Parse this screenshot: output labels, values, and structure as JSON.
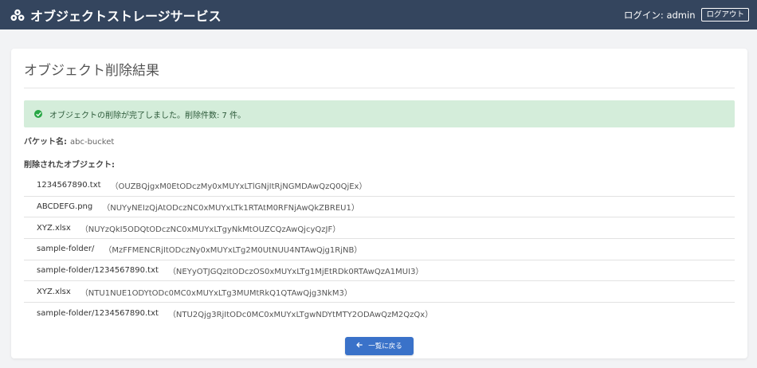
{
  "header": {
    "app_title": "オブジェクトストレージサービス",
    "login_text": "ログイン: admin",
    "logout_label": "ログアウト"
  },
  "main": {
    "title": "オブジェクト削除結果",
    "alert_message": "オブジェクトの削除が完了しました。削除件数: 7 件。",
    "bucket_label": "バケット名:",
    "bucket_value": "abc-bucket",
    "objects_label": "削除されたオブジェクト:",
    "objects": [
      {
        "name": "1234567890.txt",
        "id": "（OUZBQjgxM0EtODczMy0xMUYxLTlGNjItRjNGMDAwQzQ0QjEx）"
      },
      {
        "name": "ABCDEFG.png",
        "id": "（NUYyNEIzQjAtODczNC0xMUYxLTk1RTAtM0RFNjAwQkZBREU1）"
      },
      {
        "name": "XYZ.xlsx",
        "id": "（NUYzQkI5ODQtODczNC0xMUYxLTgyNkMtOUZCQzAwQjcyQzJF）"
      },
      {
        "name": "sample-folder/",
        "id": "（MzFFMENCRjItODczNy0xMUYxLTg2M0UtNUU4NTAwQjg1RjNB）"
      },
      {
        "name": "sample-folder/1234567890.txt",
        "id": "（NEYyOTJGQzItODczOS0xMUYxLTg1MjEtRDk0RTAwQzA1MUI3）"
      },
      {
        "name": "XYZ.xlsx",
        "id": "（NTU1NUE1ODYtODc0MC0xMUYxLTg3MUMtRkQ1QTAwQjg3NkM3）"
      },
      {
        "name": "sample-folder/1234567890.txt",
        "id": "（NTU2Qjg3RjItODc0MC0xMUYxLTgwNDYtMTY2ODAwQzM2QzQx）"
      }
    ],
    "back_button_label": "一覧に戻る"
  },
  "colors": {
    "header_bg": "#34455e",
    "alert_bg": "#d4edda",
    "success": "#28a745",
    "primary": "#3a72c9"
  },
  "icons": {
    "logo": "cubes-icon",
    "success": "check-circle-icon",
    "back": "arrow-left-icon"
  }
}
